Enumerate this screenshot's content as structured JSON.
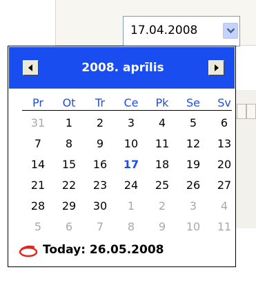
{
  "date_field": {
    "value": "17.04.2008"
  },
  "calendar": {
    "title": "2008. aprīlis",
    "weekdays": [
      "Pr",
      "Ot",
      "Tr",
      "Ce",
      "Pk",
      "Se",
      "Sv"
    ],
    "weeks": [
      [
        "31",
        "1",
        "2",
        "3",
        "4",
        "5",
        "6"
      ],
      [
        "7",
        "8",
        "9",
        "10",
        "11",
        "12",
        "13"
      ],
      [
        "14",
        "15",
        "16",
        "17",
        "18",
        "19",
        "20"
      ],
      [
        "21",
        "22",
        "23",
        "24",
        "25",
        "26",
        "27"
      ],
      [
        "28",
        "29",
        "30",
        "1",
        "2",
        "3",
        "4"
      ],
      [
        "5",
        "6",
        "7",
        "8",
        "9",
        "10",
        "11"
      ]
    ],
    "today_label": "Today: 26.05.2008",
    "selected_date": "17"
  },
  "colors": {
    "header": "#1a4df0",
    "weekday": "#1a4df0",
    "other_month": "#a8a8a8",
    "today_marker": "#e8231b"
  }
}
